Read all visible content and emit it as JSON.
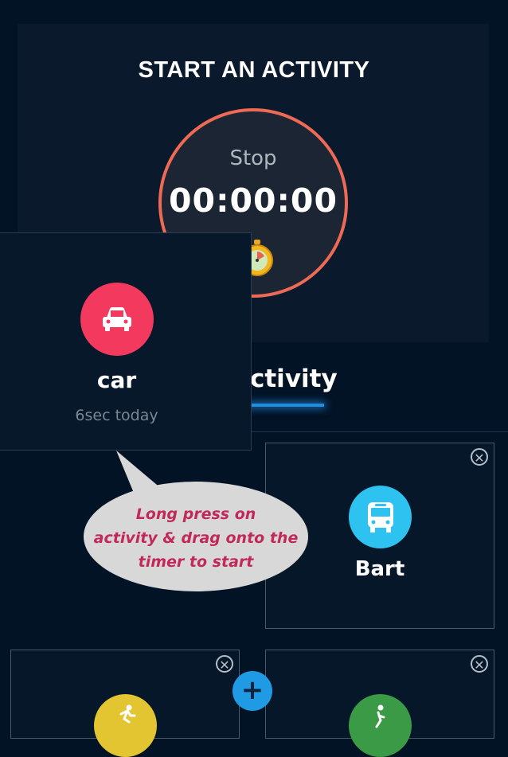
{
  "panel": {
    "title": "START AN ACTIVITY"
  },
  "timer": {
    "stop_label": "Stop",
    "value": "00:00:00"
  },
  "tab": {
    "label": "Activity"
  },
  "dragging": {
    "name": "car",
    "subtitle": "6sec today",
    "color": "#f4395f",
    "icon": "car-icon"
  },
  "tip": {
    "text_lines": [
      "Long press on",
      "activity & drag onto the",
      "timer to start"
    ]
  },
  "activities": [
    {
      "name": "Bart",
      "color": "#2ec2f0",
      "icon": "bus-icon"
    },
    {
      "name": "",
      "color": "#e2c531",
      "icon": "cycling-icon"
    },
    {
      "name": "",
      "color": "#3a9a45",
      "icon": "walking-icon"
    }
  ],
  "add_button": {
    "label": "+"
  },
  "colors": {
    "background": "#031326",
    "accent": "#ee6a55",
    "tab_indicator": "#1c8fe0"
  }
}
